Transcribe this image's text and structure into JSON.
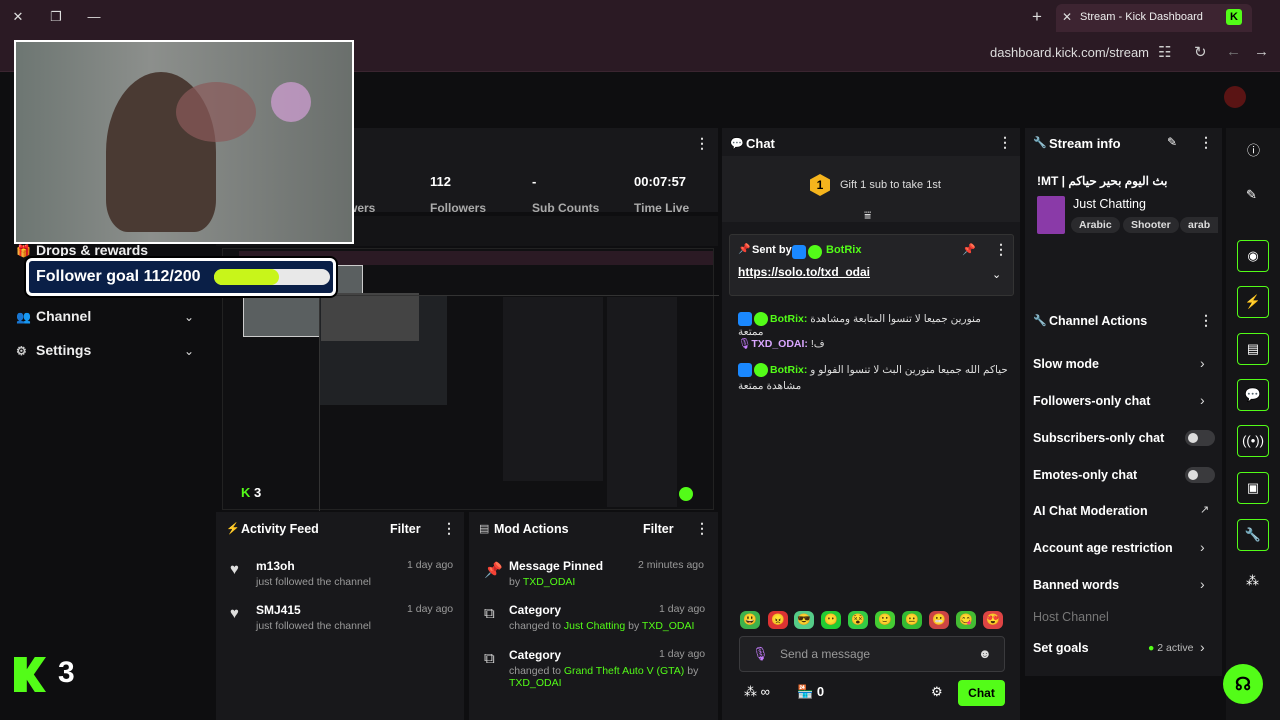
{
  "browser": {
    "tab_title": "Stream - Kick Dashboard",
    "tab_logo": "K",
    "url": "dashboard.kick.com/stream"
  },
  "sidebar": {
    "items": [
      {
        "label": "Drops & rewards",
        "icon": "gift-icon"
      },
      {
        "label": "Channel",
        "icon": "users-icon"
      },
      {
        "label": "Settings",
        "icon": "gear-icon"
      }
    ]
  },
  "overlay": {
    "follower_goal": "Follower goal 112/200",
    "follower_goal_progress": 0.56,
    "viewer_count": "3",
    "preview_viewer_count": "3"
  },
  "stats": [
    {
      "value": "",
      "label": "wers"
    },
    {
      "value": "112",
      "label": "Followers"
    },
    {
      "value": "-",
      "label": "Sub Counts"
    },
    {
      "value": "00:07:57",
      "label": "Time Live"
    }
  ],
  "activity_feed": {
    "title": "Activity Feed",
    "filter": "Filter",
    "items": [
      {
        "name": "m13oh",
        "desc": "just followed the channel",
        "time": "1 day ago"
      },
      {
        "name": "SMJ415",
        "desc": "just followed the channel",
        "time": "1 day ago"
      }
    ]
  },
  "mod_actions": {
    "title": "Mod Actions",
    "filter": "Filter",
    "items": [
      {
        "title": "Message Pinned",
        "pre": "by ",
        "hl1": "TXD_ODAI",
        "mid": "",
        "hl2": "",
        "time": "2 minutes ago"
      },
      {
        "title": "Category",
        "pre": "changed to ",
        "hl1": "Just Chatting",
        "mid": " by ",
        "hl2": "TXD_ODAI",
        "time": "1 day ago"
      },
      {
        "title": "Category",
        "pre": "changed to ",
        "hl1": "Grand Theft Auto V (GTA)",
        "mid": " by ",
        "hl2": "TXD_ODAI",
        "time": "1 day ago"
      }
    ]
  },
  "chat": {
    "title": "Chat",
    "gift_badge": "1",
    "gift_text": "Gift 1 sub to take 1st",
    "pinned_sent_by": "Sent by",
    "pinned_author": "BotRix",
    "pinned_link": "https://solo.to/txd_odai",
    "messages": [
      {
        "user": "BotRix:",
        "text": "منورين جميعا لا تنسوا المتابعة ومشاهدة ممتعة"
      },
      {
        "user": "TXD_ODAI:",
        "text": "!ف"
      },
      {
        "user": "BotRix:",
        "text": "حياكم الله جميعا منورين البث لا تنسوا الفولو و مشاهدة ممتعة"
      }
    ],
    "input_placeholder": "Send a message",
    "viewers_icon_value": "∞",
    "store_count": "0",
    "send_label": "Chat"
  },
  "stream_info": {
    "title": "Stream info",
    "stream_title": "!MT | بث اليوم بحير حياكم",
    "category": "Just Chatting",
    "tags": [
      "Arabic",
      "Shooter",
      "arab"
    ]
  },
  "channel_actions": {
    "title": "Channel Actions",
    "items": [
      {
        "label": "Slow mode",
        "control": "chevron"
      },
      {
        "label": "Followers-only chat",
        "control": "chevron"
      },
      {
        "label": "Subscribers-only chat",
        "control": "toggle"
      },
      {
        "label": "Emotes-only chat",
        "control": "toggle"
      },
      {
        "label": "AI Chat Moderation",
        "control": "external"
      },
      {
        "label": "Account age restriction",
        "control": "chevron"
      },
      {
        "label": "Banned words",
        "control": "chevron"
      },
      {
        "label": "Host Channel",
        "control": "none"
      },
      {
        "label": "Set goals",
        "control": "chevron",
        "status": "2 active"
      }
    ]
  },
  "colors": {
    "accent": "#53fc18",
    "bg": "#0e0e10",
    "panel": "#18181b",
    "browser": "#2b1a24"
  }
}
